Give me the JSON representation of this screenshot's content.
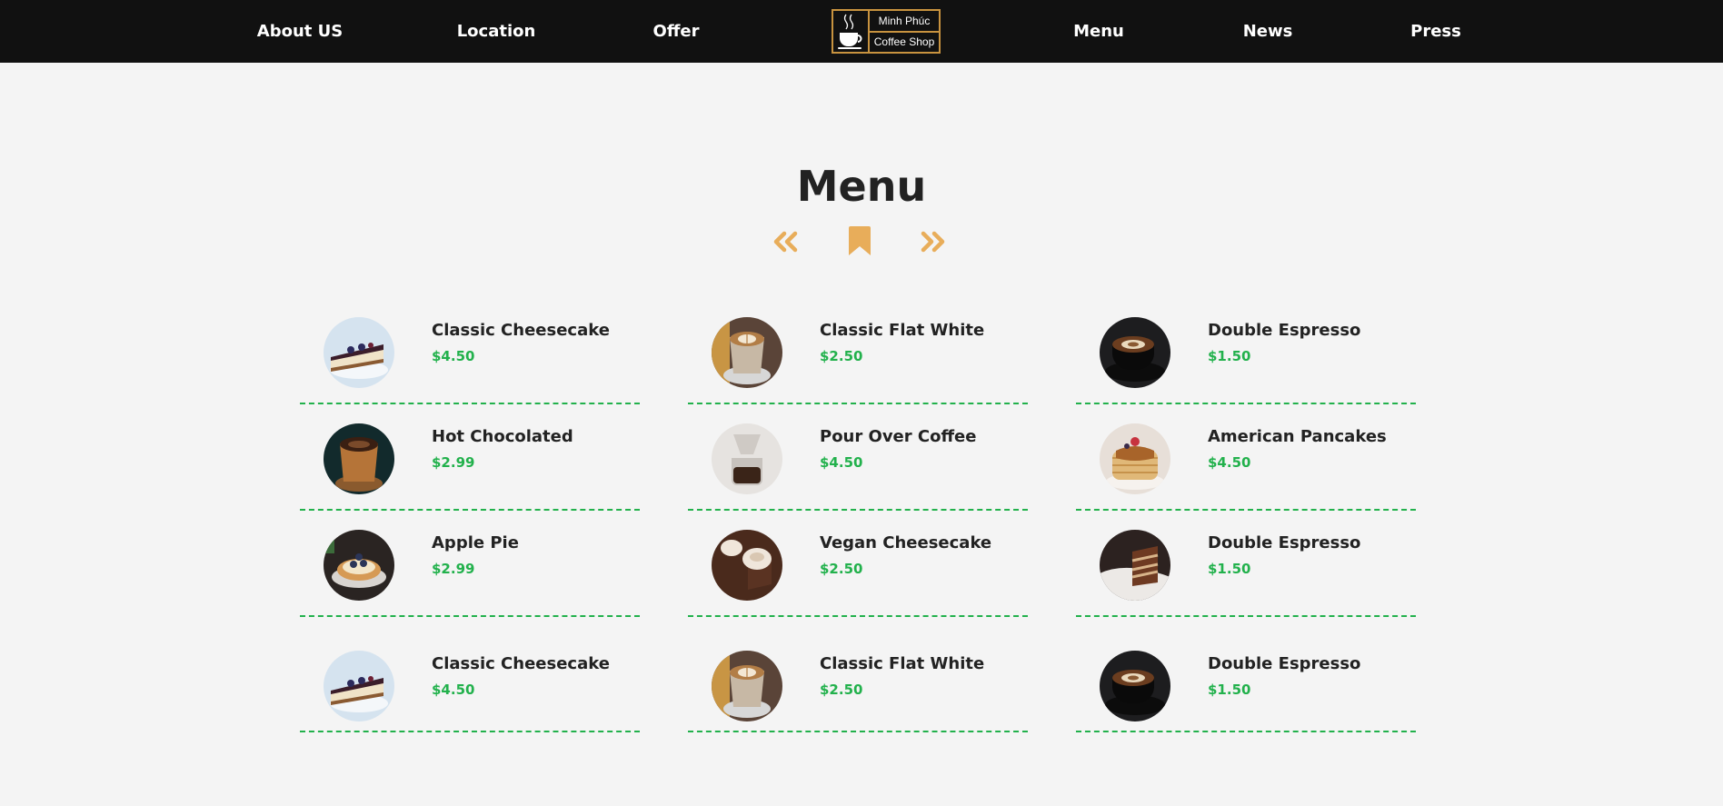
{
  "nav": {
    "left": [
      "About US",
      "Location",
      "Offer"
    ],
    "right": [
      "Menu",
      "News",
      "Press"
    ]
  },
  "logo": {
    "line1": "Minh Phúc",
    "line2": "Coffee Shop",
    "icon": "coffee-cup-icon"
  },
  "menu": {
    "title": "Menu",
    "controls": {
      "prev_icon": "double-chevron-left-icon",
      "center_icon": "bookmark-icon",
      "next_icon": "double-chevron-right-icon"
    },
    "items": [
      {
        "name": "Classic Cheesecake",
        "price": "$4.50",
        "image": "cheesecake-photo"
      },
      {
        "name": "Classic Flat White",
        "price": "$2.50",
        "image": "flat-white-photo"
      },
      {
        "name": "Double Espresso",
        "price": "$1.50",
        "image": "espresso-cup-photo"
      },
      {
        "name": "Hot Chocolated",
        "price": "$2.99",
        "image": "hot-chocolate-photo"
      },
      {
        "name": "Pour Over Coffee",
        "price": "$4.50",
        "image": "pour-over-photo"
      },
      {
        "name": "American Pancakes",
        "price": "$4.50",
        "image": "pancakes-photo"
      },
      {
        "name": "Apple Pie",
        "price": "$2.99",
        "image": "pie-photo"
      },
      {
        "name": "Vegan Cheesecake",
        "price": "$2.50",
        "image": "vegan-cheesecake-photo"
      },
      {
        "name": "Double Espresso",
        "price": "$1.50",
        "image": "cake-slice-photo"
      },
      {
        "name": "Classic Cheesecake",
        "price": "$4.50",
        "image": "cheesecake-photo"
      },
      {
        "name": "Classic Flat White",
        "price": "$2.50",
        "image": "flat-white-photo"
      },
      {
        "name": "Double Espresso",
        "price": "$1.50",
        "image": "espresso-cup-photo"
      }
    ]
  },
  "colors": {
    "nav_bg": "#111111",
    "accent": "#e8ad5a",
    "logo_border": "#c8933f",
    "price": "#22b14c",
    "divider": "#22b14c",
    "page_bg": "#f4f4f4"
  }
}
